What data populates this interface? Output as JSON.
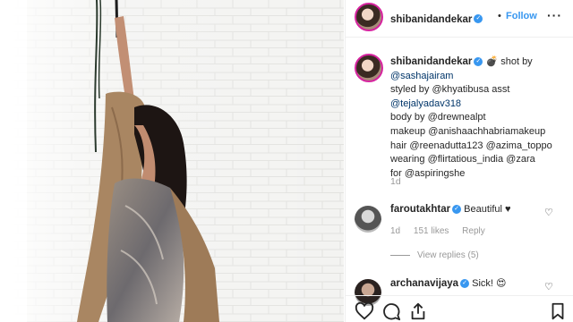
{
  "header": {
    "username": "shibanidandekar",
    "separator": "•",
    "follow_label": "Follow",
    "more_label": "···"
  },
  "caption": {
    "username": "shibanidandekar",
    "lines": [
      "shot by",
      "@sashajairam",
      "styled by @khyatibusa asst",
      "@tejalyadav318",
      "body by @drewnealpt",
      "makeup @anishaachhabriamakeup",
      "hair @reenadutta123 @azima_toppo",
      "wearing @flirtatious_india @zara",
      "for @aspiringshe"
    ],
    "time": "1d"
  },
  "comments": [
    {
      "username": "faroutakhtar",
      "text": "Beautiful ♥",
      "time": "1d",
      "likes": "151 likes",
      "reply_label": "Reply",
      "view_replies": "View replies (5)"
    },
    {
      "username": "archanavijaya",
      "text": "Sick! 😍"
    }
  ],
  "actions": {
    "like": "heart-icon",
    "comment": "comment-icon",
    "share": "share-icon",
    "save": "bookmark-icon"
  },
  "colors": {
    "accent": "#3897f0",
    "mention": "#003569",
    "muted": "#999999"
  }
}
